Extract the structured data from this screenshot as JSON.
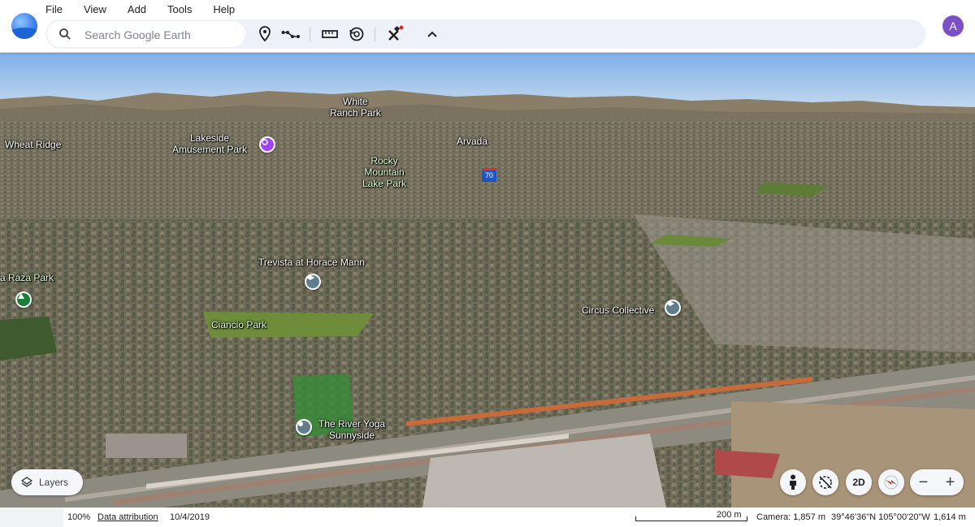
{
  "menu": [
    "File",
    "View",
    "Add",
    "Tools",
    "Help"
  ],
  "search": {
    "placeholder": "Search Google Earth"
  },
  "toolbar": {
    "icons": [
      "placemark-icon",
      "path-icon",
      "ruler-icon",
      "history-icon",
      "voyager-icon",
      "collapse-icon"
    ]
  },
  "user": {
    "initial": "A"
  },
  "map_labels": {
    "white_ranch": "White\nRanch Park",
    "wheat_ridge": "Wheat Ridge",
    "lakeside": "Lakeside\nAmusement Park",
    "arvada": "Arvada",
    "rocky_mountain_lake": "Rocky\nMountain\nLake Park",
    "highway": "70",
    "trevista": "Trevista at Horace Mann",
    "la_raza": "a Raza Park",
    "circus": "Circus Collective",
    "ciancio": "Ciancio Park",
    "river_yoga": "The River Yoga\nSunnyside"
  },
  "controls": {
    "layers_label": "Layers",
    "mode_2d": "2D",
    "zoom_out": "−",
    "zoom_in": "+"
  },
  "status": {
    "zoom": "100%",
    "attribution": "Data attribution",
    "date": "10/4/2019",
    "scale": "200 m",
    "camera": "Camera: 1,857 m",
    "coords": "39°46'36\"N 105°00'20\"W",
    "elevation": "1,614 m"
  },
  "colors": {
    "accent": "#4285f4",
    "avatar": "#7b4fc8",
    "toolbar_bg": "#eef2f8",
    "sky": "#a9c8ea"
  }
}
